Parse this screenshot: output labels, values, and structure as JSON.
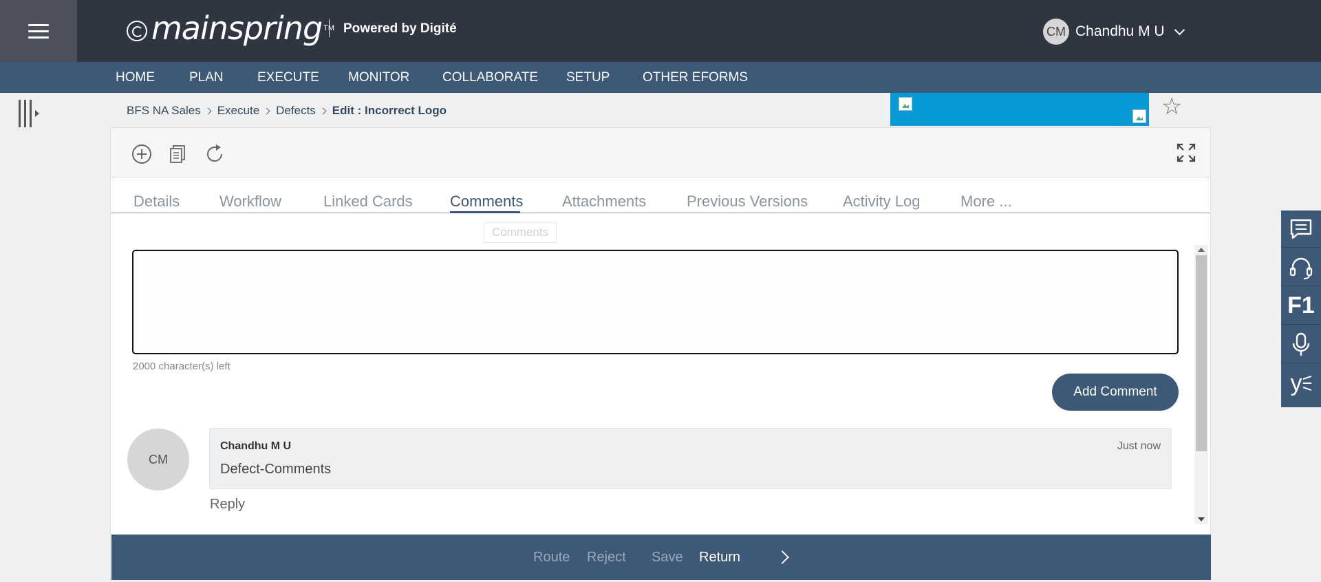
{
  "header": {
    "logo_text": "mainspring",
    "logo_tm": "TM",
    "powered_by": "Powered by Digité",
    "user_initials": "CM",
    "user_name": "Chandhu M U"
  },
  "nav": {
    "items": [
      "HOME",
      "PLAN",
      "EXECUTE",
      "MONITOR",
      "COLLABORATE",
      "SETUP",
      "OTHER EFORMS"
    ]
  },
  "breadcrumb": {
    "items": [
      "BFS NA Sales",
      "Execute",
      "Defects"
    ],
    "current": "Edit : Incorrect Logo"
  },
  "tabs": {
    "items": [
      "Details",
      "Workflow",
      "Linked Cards",
      "Comments",
      "Attachments",
      "Previous Versions",
      "Activity Log",
      "More ..."
    ],
    "active": "Comments",
    "tooltip": "Comments"
  },
  "comment_form": {
    "value": "",
    "chars_left": "2000 character(s) left",
    "add_button": "Add Comment"
  },
  "comments": [
    {
      "avatar": "CM",
      "author": "Chandhu M U",
      "time": "Just now",
      "text": "Defect-Comments",
      "reply": "Reply"
    }
  ],
  "footer": {
    "route": "Route",
    "reject": "Reject",
    "save": "Save",
    "return": "Return"
  },
  "widgets": {
    "f1_label": "F1",
    "y_label": "y"
  },
  "colors": {
    "topbar": "#2f3541",
    "nav": "#3e5878",
    "banner": "#0799d6",
    "accent": "#3e5878"
  }
}
